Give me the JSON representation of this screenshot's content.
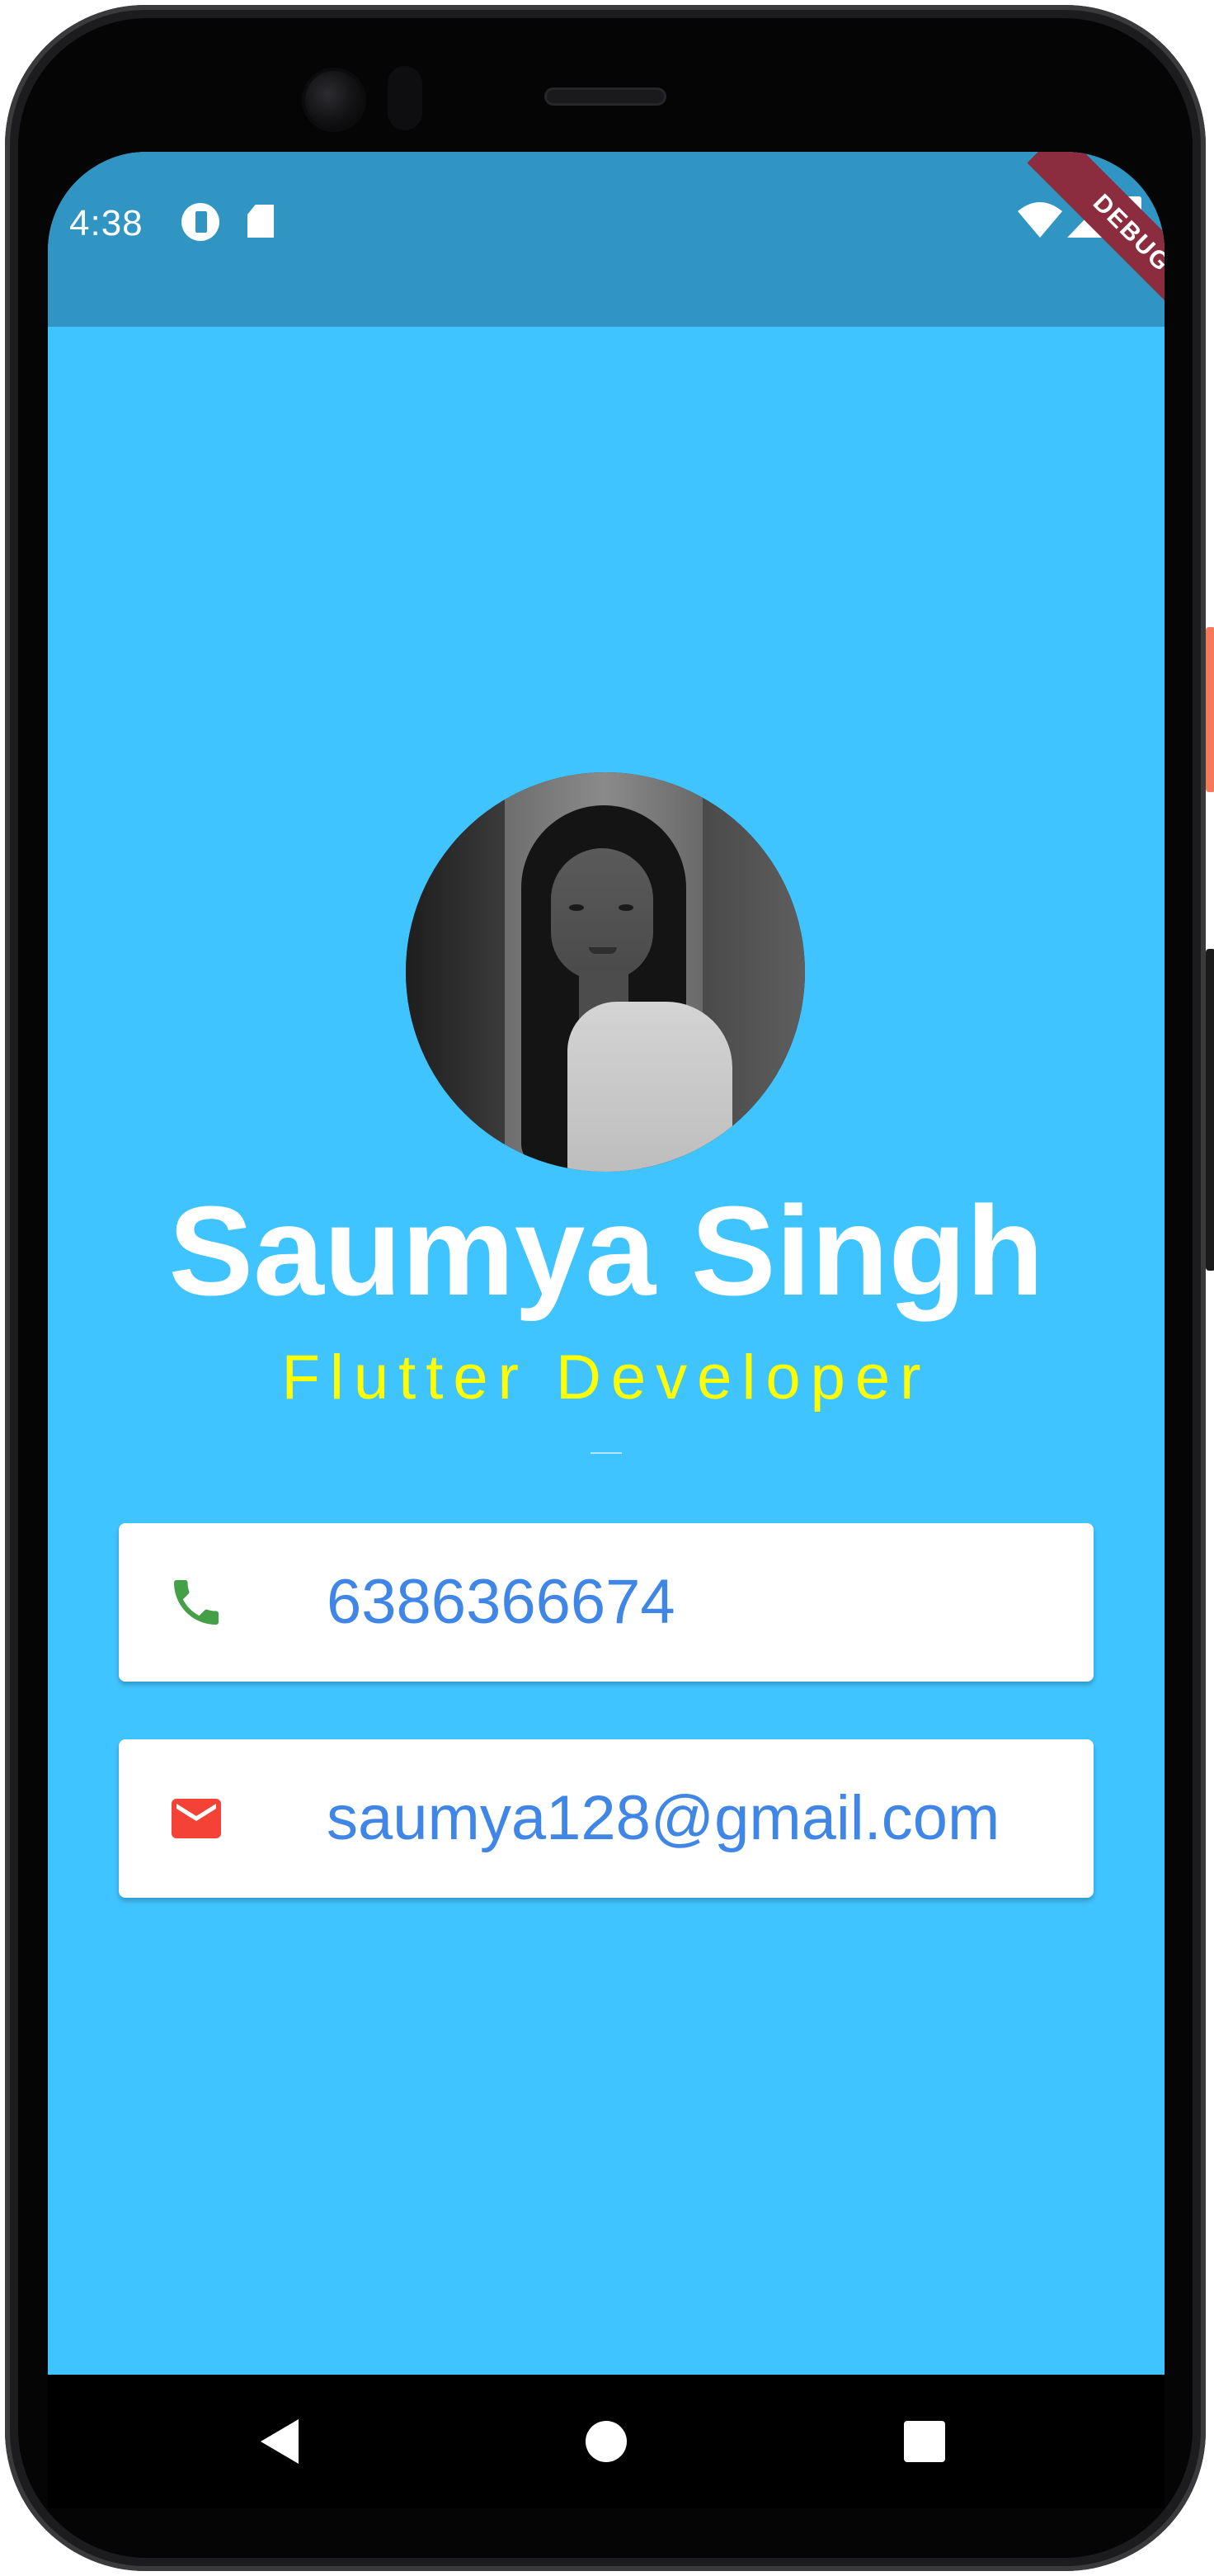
{
  "status_bar": {
    "time": "4:38",
    "icons": [
      "app-notification-icon",
      "sd-card-icon",
      "wifi-icon",
      "cell-signal-icon",
      "battery-icon"
    ]
  },
  "debug_banner": {
    "label": "DEBUG",
    "color": "#8b2c3f"
  },
  "profile": {
    "name": "Saumya Singh",
    "title": "Flutter Developer",
    "avatar_icon": "profile-photo"
  },
  "contacts": [
    {
      "icon": "phone-icon",
      "value": "6386366674",
      "icon_color": "#43a047"
    },
    {
      "icon": "email-icon",
      "value": "saumya128@gmail.com",
      "icon_color": "#f44336"
    }
  ],
  "nav": {
    "back_icon": "back-triangle-icon",
    "home_icon": "home-circle-icon",
    "recents_icon": "recents-square-icon"
  },
  "colors": {
    "background": "#40c4ff",
    "status_bar": "#3195c3",
    "name_text": "#ffffff",
    "title_text": "#ffff00",
    "contact_text": "#3f86e6",
    "card": "#ffffff"
  }
}
